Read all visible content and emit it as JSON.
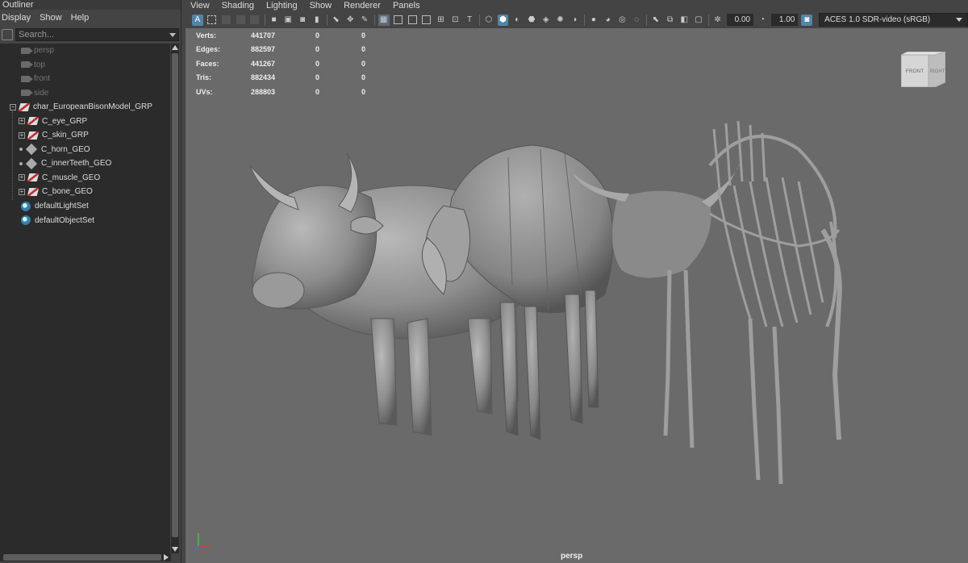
{
  "outliner": {
    "title": "Outliner",
    "menu": [
      "Display",
      "Show",
      "Help"
    ],
    "search_placeholder": "Search...",
    "items": [
      {
        "label": "persp",
        "type": "camera",
        "dim": true
      },
      {
        "label": "top",
        "type": "camera",
        "dim": true
      },
      {
        "label": "front",
        "type": "camera",
        "dim": true
      },
      {
        "label": "side",
        "type": "camera",
        "dim": true
      },
      {
        "label": "char_EuropeanBisonModel_GRP",
        "type": "group",
        "dim": false
      },
      {
        "label": "C_eye_GRP",
        "type": "group",
        "dim": false
      },
      {
        "label": "C_skin_GRP",
        "type": "group",
        "dim": false
      },
      {
        "label": "C_horn_GEO",
        "type": "geo",
        "dim": false
      },
      {
        "label": "C_innerTeeth_GEO",
        "type": "geo",
        "dim": false
      },
      {
        "label": "C_muscle_GEO",
        "type": "group",
        "dim": false
      },
      {
        "label": "C_bone_GEO",
        "type": "group",
        "dim": false
      },
      {
        "label": "defaultLightSet",
        "type": "set",
        "dim": false
      },
      {
        "label": "defaultObjectSet",
        "type": "set",
        "dim": false
      }
    ]
  },
  "viewport": {
    "menu": [
      "View",
      "Shading",
      "Lighting",
      "Show",
      "Renderer",
      "Panels"
    ],
    "exposure": "0.00",
    "gamma": "1.00",
    "colorspace": "ACES 1.0 SDR-video (sRGB)",
    "camera": "persp",
    "viewcube": {
      "front": "FRONT",
      "right": "RIGHT"
    },
    "hud": [
      {
        "key": "Verts:",
        "v1": "441707",
        "v2": "0",
        "v3": "0"
      },
      {
        "key": "Edges:",
        "v1": "882597",
        "v2": "0",
        "v3": "0"
      },
      {
        "key": "Faces:",
        "v1": "441267",
        "v2": "0",
        "v3": "0"
      },
      {
        "key": "Tris:",
        "v1": "882434",
        "v2": "0",
        "v3": "0"
      },
      {
        "key": "UVs:",
        "v1": "288803",
        "v2": "0",
        "v3": "0"
      }
    ]
  }
}
